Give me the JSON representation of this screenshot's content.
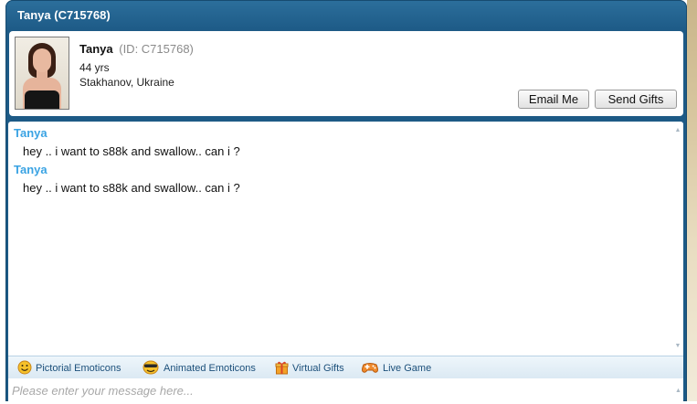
{
  "window": {
    "title_name": "Tanya",
    "title_id": "(C715768)"
  },
  "profile": {
    "name": "Tanya",
    "id_text": "(ID: C715768)",
    "age": "44 yrs",
    "location": "Stakhanov, Ukraine",
    "email_label": "Email Me",
    "gifts_label": "Send Gifts"
  },
  "messages": [
    {
      "sender": "Tanya",
      "text": "hey .. i want to s88k and swallow.. can i ?"
    },
    {
      "sender": "Tanya",
      "text": "hey .. i want to s88k and swallow.. can i ?"
    }
  ],
  "toolbar": {
    "items": [
      {
        "label": "Pictorial Emoticons",
        "icon": "smiley-icon"
      },
      {
        "label": "Animated Emoticons",
        "icon": "animated-smiley-icon"
      },
      {
        "label": "Virtual Gifts",
        "icon": "gift-icon"
      },
      {
        "label": "Live Game",
        "icon": "gamepad-icon"
      }
    ]
  },
  "input": {
    "placeholder": "Please enter your message here..."
  },
  "colors": {
    "title_bar": "#1d5a86",
    "sender_name": "#3aa3e3",
    "toolbar_text": "#1b4f7a"
  }
}
